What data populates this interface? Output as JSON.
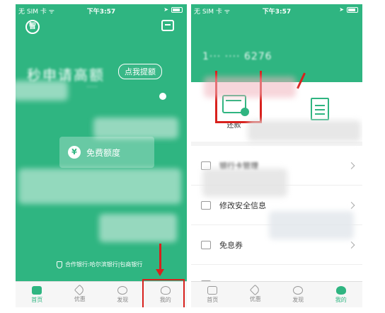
{
  "status": {
    "carrier": "无 SIM 卡 ᯤ",
    "time": "下午3:57"
  },
  "left": {
    "logo_char": "智",
    "headline": "秒申请高额",
    "remind_label": "点我提额",
    "sub_text": "·····",
    "quota_button": "免费额度",
    "yen_symbol": "¥",
    "partner_text": "合作银行:哈尔滨银行|包商银行",
    "tabs": [
      "首页",
      "优惠",
      "发现",
      "我的"
    ],
    "active_tab": "我的"
  },
  "right": {
    "phone_number": "1··· ···· 6276",
    "cards": [
      "还款",
      ""
    ],
    "rows": [
      {
        "label": "银行卡管理"
      },
      {
        "label": "修改安全信息"
      },
      {
        "label": "免息券"
      },
      {
        "label": ""
      }
    ],
    "tabs": [
      "首页",
      "优惠",
      "发现",
      "我的"
    ],
    "active_tab": "我的"
  },
  "colors": {
    "brand_green": "#2fb581",
    "highlight_red": "#d8211d"
  }
}
